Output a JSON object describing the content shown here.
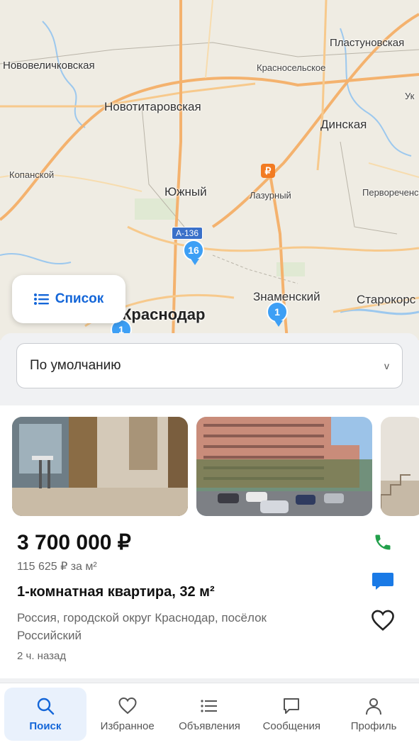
{
  "map": {
    "places": [
      {
        "name": "Пластуновская"
      },
      {
        "name": "Нововеличковская"
      },
      {
        "name": "Красносельское"
      },
      {
        "name": "Ук"
      },
      {
        "name": "Новотитаровская"
      },
      {
        "name": "Динская"
      },
      {
        "name": "Копанской"
      },
      {
        "name": "Южный"
      },
      {
        "name": "Лазурный"
      },
      {
        "name": "Первореченск"
      },
      {
        "name": "Знаменский"
      },
      {
        "name": "Старокорс"
      },
      {
        "name": "Краснодар"
      }
    ],
    "road_badge": "А-136",
    "ruble_badge": "₽",
    "clusters": [
      "16",
      "1",
      "1"
    ],
    "list_button_label": "Список"
  },
  "sort": {
    "value": "По умолчанию",
    "chevron": "v"
  },
  "listing": {
    "price": "3 700 000 ₽",
    "price_per_m2": "115 625 ₽ за м²",
    "title": "1-комнатная квартира, 32 м²",
    "address": "Россия, городской округ Краснодар, посёлок Российский",
    "time": "2 ч. назад",
    "icons": [
      "phone-icon",
      "chat-icon",
      "heart-icon"
    ]
  },
  "nav": {
    "items": [
      {
        "label": "Поиск",
        "icon": "search-icon",
        "active": true
      },
      {
        "label": "Избранное",
        "icon": "heart-icon",
        "active": false
      },
      {
        "label": "Объявления",
        "icon": "list-icon",
        "active": false
      },
      {
        "label": "Сообщения",
        "icon": "message-icon",
        "active": false
      },
      {
        "label": "Профиль",
        "icon": "profile-icon",
        "active": false
      }
    ]
  },
  "colors": {
    "accent": "#1466d8",
    "map_cluster": "#3d9ff5",
    "phone_green": "#22a04b",
    "chat_blue": "#1a7ae6"
  }
}
